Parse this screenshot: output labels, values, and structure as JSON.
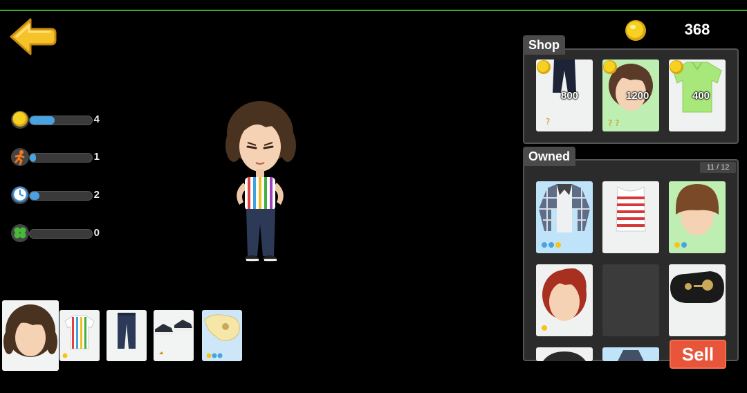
{
  "header": {
    "coins": "368",
    "accent_color": "#3aa82e",
    "back_icon": "back-arrow-icon"
  },
  "stats": [
    {
      "icon": "coin-icon",
      "value": "4",
      "fill": 0.4
    },
    {
      "icon": "runner-icon",
      "value": "1",
      "fill": 0.1
    },
    {
      "icon": "clock-icon",
      "value": "2",
      "fill": 0.15
    },
    {
      "icon": "clover-icon",
      "value": "0",
      "fill": 0.0
    }
  ],
  "equipped": [
    "hair-item",
    "striped-shirt-item",
    "jeans-item",
    "sneakers-item",
    "guitar-item"
  ],
  "shop": {
    "title": "Shop",
    "items": [
      {
        "name": "pants",
        "price": "800"
      },
      {
        "name": "brown-hair",
        "price": "1200"
      },
      {
        "name": "green-polo",
        "price": "400"
      }
    ]
  },
  "owned": {
    "title": "Owned",
    "count": "11 / 12",
    "items": [
      "plaid-jacket",
      "striped-tank",
      "bowl-haircut",
      "red-hair",
      "empty-slot",
      "guitar-case",
      "item-7",
      "item-8"
    ]
  },
  "sell_label": "Sell",
  "colors": {
    "coin": "#f5c518",
    "sell": "#e8553a",
    "bar_fill": "#4aa3e0"
  }
}
